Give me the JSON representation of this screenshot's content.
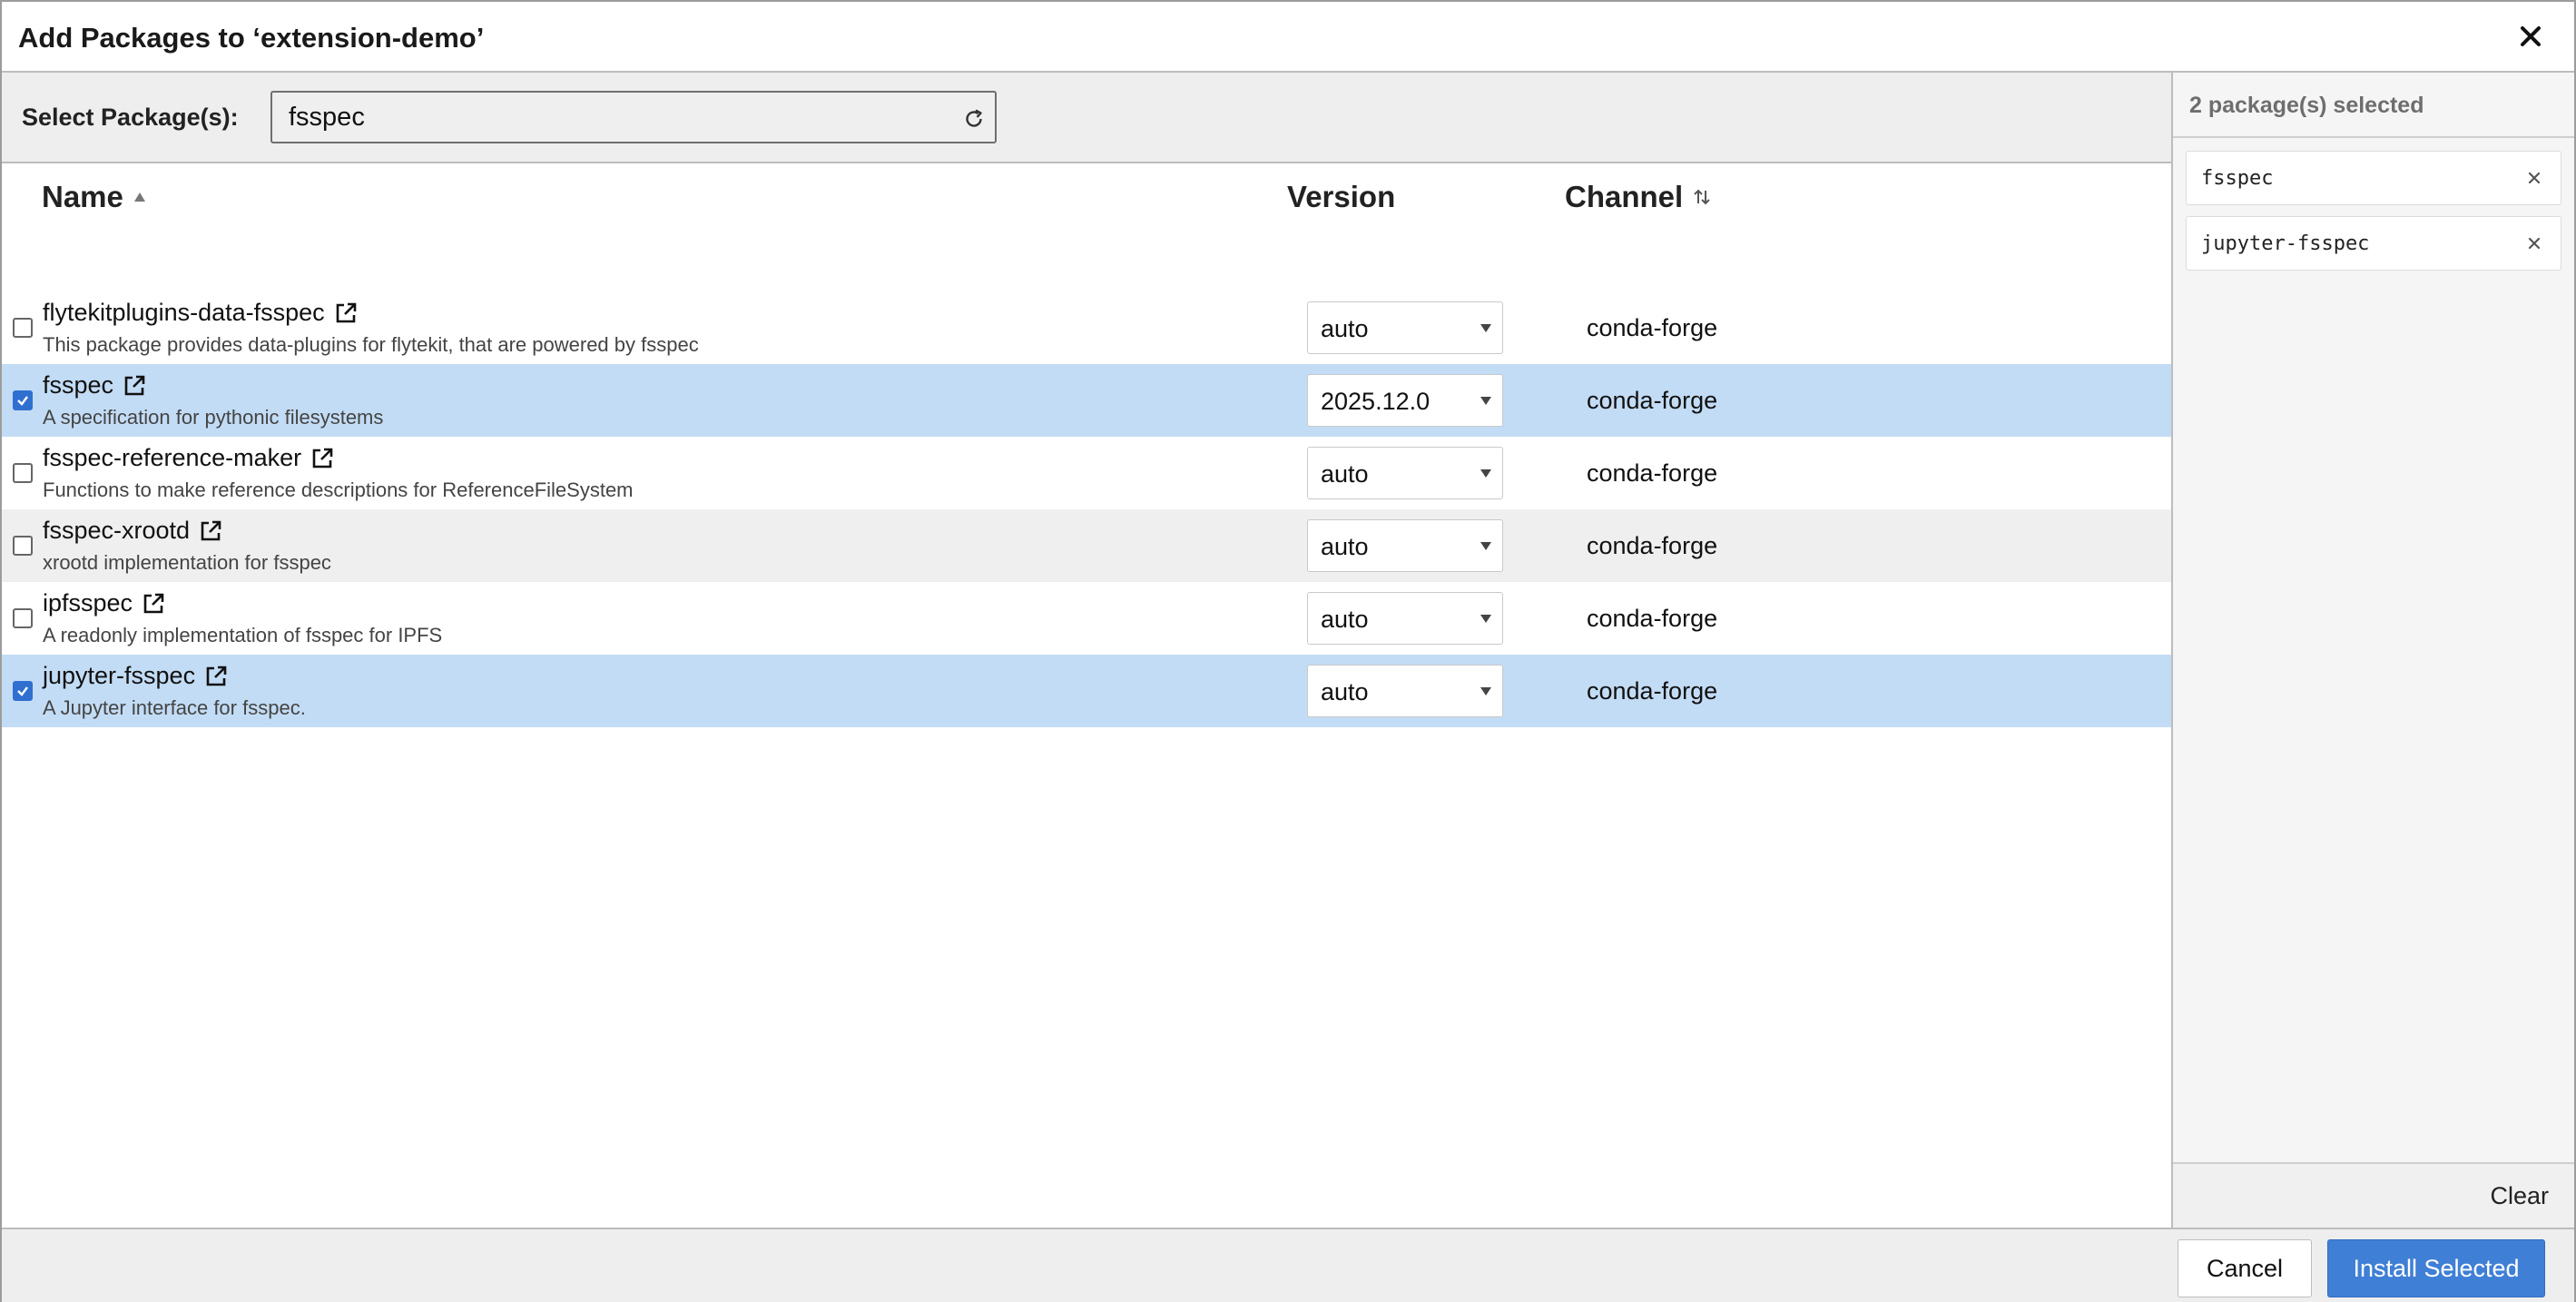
{
  "dialog": {
    "title": "Add Packages to ‘extension-demo’"
  },
  "search": {
    "label": "Select Package(s):",
    "value": "fsspec"
  },
  "table": {
    "columns": {
      "name": "Name",
      "version": "Version",
      "channel": "Channel"
    },
    "rows": [
      {
        "name": "flytekitplugins-data-fsspec",
        "description": "This package provides data-plugins for flytekit, that are powered by fsspec",
        "version": "auto",
        "channel": "conda-forge",
        "checked": false
      },
      {
        "name": "fsspec",
        "description": "A specification for pythonic filesystems",
        "version": "2025.12.0",
        "channel": "conda-forge",
        "checked": true
      },
      {
        "name": "fsspec-reference-maker",
        "description": "Functions to make reference descriptions for ReferenceFileSystem",
        "version": "auto",
        "channel": "conda-forge",
        "checked": false
      },
      {
        "name": "fsspec-xrootd",
        "description": "xrootd implementation for fsspec",
        "version": "auto",
        "channel": "conda-forge",
        "checked": false
      },
      {
        "name": "ipfsspec",
        "description": "A readonly implementation of fsspec for IPFS",
        "version": "auto",
        "channel": "conda-forge",
        "checked": false
      },
      {
        "name": "jupyter-fsspec",
        "description": "A Jupyter interface for fsspec.",
        "version": "auto",
        "channel": "conda-forge",
        "checked": true
      }
    ]
  },
  "selection": {
    "count_label": "2 package(s) selected",
    "items": [
      "fsspec",
      "jupyter-fsspec"
    ],
    "clear_label": "Clear"
  },
  "footer": {
    "cancel_label": "Cancel",
    "install_label": "Install Selected"
  },
  "icons": {
    "close": "close-icon",
    "refresh": "refresh-icon",
    "sort_asc": "sort-ascending-icon",
    "sort_toggle": "sort-toggle-icon",
    "external_link": "external-link-icon",
    "remove": "remove-icon"
  },
  "colors": {
    "selected_row": "#c3dcf5",
    "alt_row": "#efefef",
    "primary_button": "#3f7fd6",
    "checkbox_checked": "#2f6fd0"
  }
}
